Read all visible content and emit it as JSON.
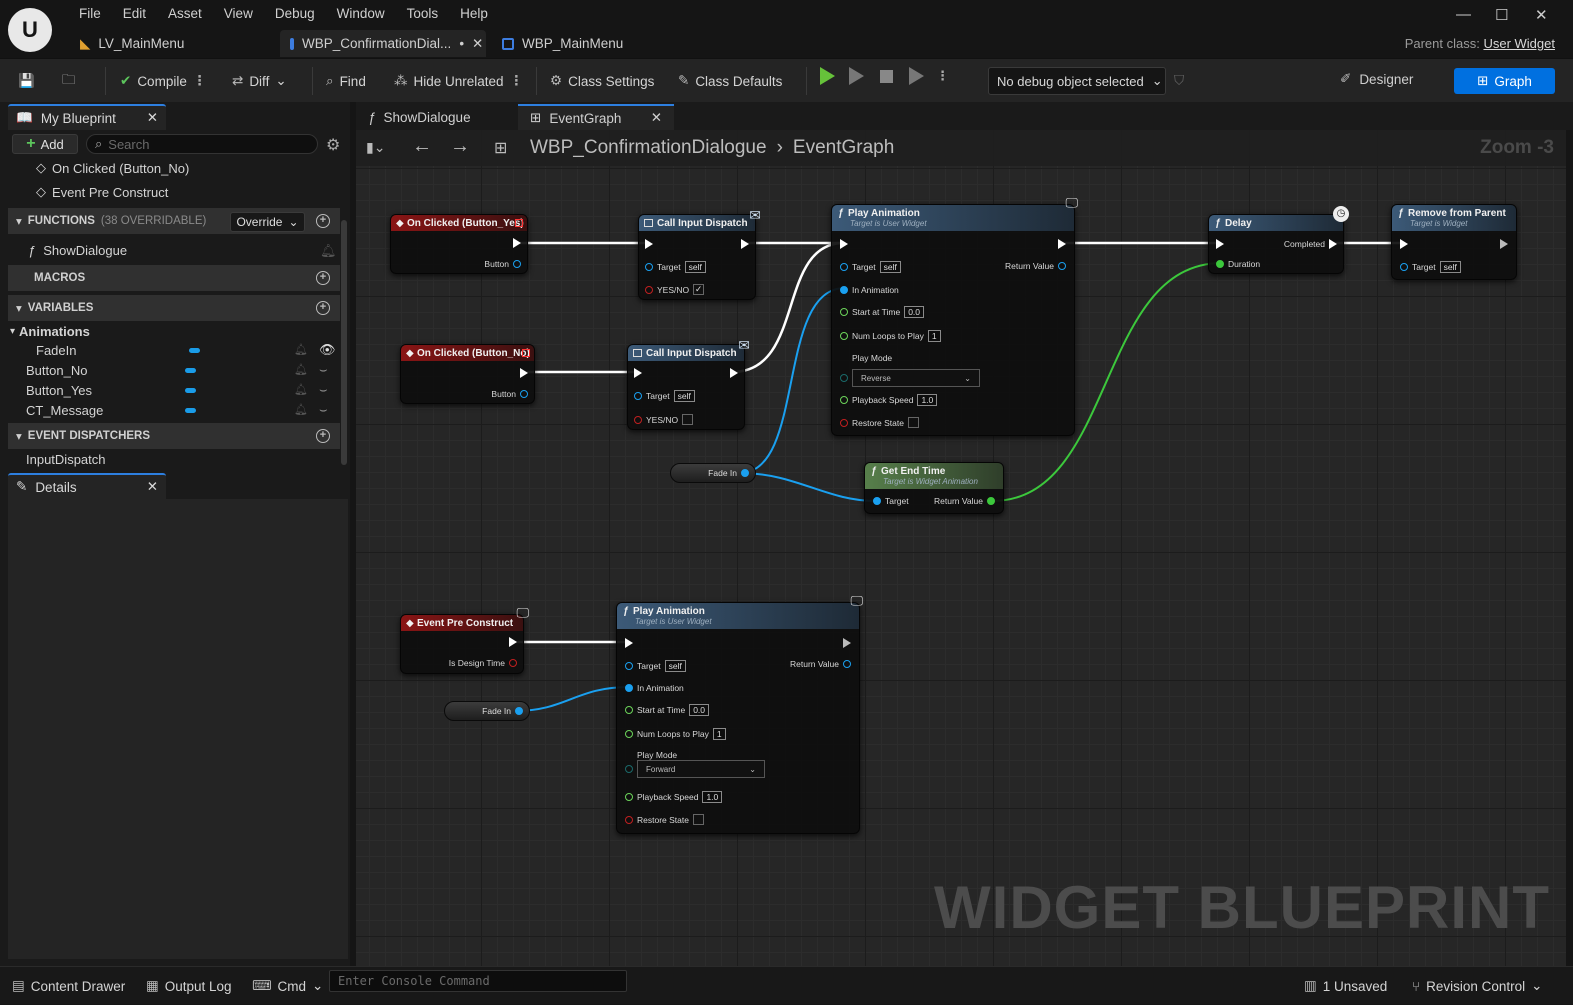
{
  "titlebar": {
    "menu": [
      "File",
      "Edit",
      "Asset",
      "View",
      "Debug",
      "Window",
      "Tools",
      "Help"
    ],
    "tabs": [
      {
        "label": "LV_MainMenu"
      },
      {
        "label": "WBP_ConfirmationDial...",
        "modified": "•"
      },
      {
        "label": "WBP_MainMenu"
      }
    ],
    "parent_class_label": "Parent class:",
    "parent_class_value": "User Widget"
  },
  "toolbar": {
    "compile": "Compile",
    "diff": "Diff",
    "find": "Find",
    "hide_unrelated": "Hide Unrelated",
    "class_settings": "Class Settings",
    "class_defaults": "Class Defaults",
    "debug_object": "No debug object selected",
    "designer": "Designer",
    "graph": "Graph"
  },
  "my_blueprint": {
    "tab": "My Blueprint",
    "add": "Add",
    "search_placeholder": "Search",
    "events": [
      "On Clicked (Button_No)",
      "Event Pre Construct"
    ],
    "functions_label": "FUNCTIONS",
    "functions_count": "(38 OVERRIDABLE)",
    "override": "Override",
    "functions": [
      "ShowDialogue"
    ],
    "macros_label": "MACROS",
    "variables_label": "VARIABLES",
    "animations_label": "Animations",
    "animations": [
      "FadeIn"
    ],
    "variables": [
      "Button_No",
      "Button_Yes",
      "CT_Message"
    ],
    "dispatchers_label": "EVENT DISPATCHERS",
    "dispatchers": [
      "InputDispatch"
    ]
  },
  "details": {
    "tab": "Details"
  },
  "graph": {
    "tabs": [
      "ShowDialogue",
      "EventGraph"
    ],
    "breadcrumb": [
      "WBP_ConfirmationDialogue",
      "EventGraph"
    ],
    "zoom": "Zoom -3",
    "watermark": "WIDGET BLUEPRINT",
    "nodes": {
      "on_clicked_yes": {
        "title": "On Clicked (Button_Yes)",
        "pin": "Button"
      },
      "on_clicked_no": {
        "title": "On Clicked (Button_No)",
        "pin": "Button"
      },
      "call_dispatch_1": {
        "title": "Call Input Dispatch",
        "target": "Target",
        "self": "self",
        "yesno": "YES/NO"
      },
      "call_dispatch_2": {
        "title": "Call Input Dispatch",
        "target": "Target",
        "self": "self",
        "yesno": "YES/NO"
      },
      "play_anim_1": {
        "title": "Play Animation",
        "subtitle": "Target is User Widget",
        "target": "Target",
        "self": "self",
        "return": "Return Value",
        "in_anim": "In Animation",
        "start": "Start at Time",
        "start_val": "0.0",
        "loops": "Num Loops to Play",
        "loops_val": "1",
        "mode": "Play Mode",
        "mode_val": "Reverse",
        "speed": "Playback Speed",
        "speed_val": "1.0",
        "restore": "Restore State"
      },
      "delay": {
        "title": "Delay",
        "completed": "Completed",
        "duration": "Duration"
      },
      "remove": {
        "title": "Remove from Parent",
        "subtitle": "Target is Widget",
        "target": "Target",
        "self": "self"
      },
      "fade_in_1": {
        "label": "Fade In"
      },
      "get_end_time": {
        "title": "Get End Time",
        "subtitle": "Target is Widget Animation",
        "target": "Target",
        "return": "Return Value"
      },
      "pre_construct": {
        "title": "Event Pre Construct",
        "pin": "Is Design Time"
      },
      "fade_in_2": {
        "label": "Fade In"
      },
      "play_anim_2": {
        "title": "Play Animation",
        "subtitle": "Target is User Widget",
        "target": "Target",
        "self": "self",
        "return": "Return Value",
        "in_anim": "In Animation",
        "start": "Start at Time",
        "start_val": "0.0",
        "loops": "Num Loops to Play",
        "loops_val": "1",
        "mode": "Play Mode",
        "mode_val": "Forward",
        "speed": "Playback Speed",
        "speed_val": "1.0",
        "restore": "Restore State"
      }
    }
  },
  "statusbar": {
    "content_drawer": "Content Drawer",
    "output_log": "Output Log",
    "cmd": "Cmd",
    "console_placeholder": "Enter Console Command",
    "unsaved": "1 Unsaved",
    "revision": "Revision Control"
  },
  "colors": {
    "accent": "#0070e0",
    "exec": "#ffffff",
    "object_pin": "#1aa0f0",
    "float_pin": "#3cc83c",
    "event_header": "#8a1515",
    "function_header": "#3c5a78",
    "pure_header": "#577f4b"
  }
}
